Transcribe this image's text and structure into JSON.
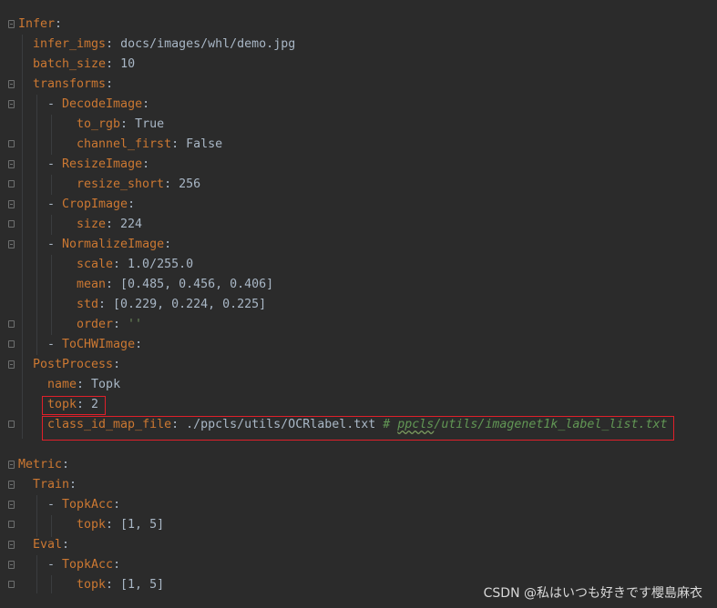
{
  "editor": {
    "lines": [
      {
        "key": "Infer",
        "sep": ":",
        "val": "",
        "comment": ""
      },
      {
        "key": "infer_imgs",
        "sep": ": ",
        "val": "docs/images/whl/demo.jpg",
        "comment": ""
      },
      {
        "key": "batch_size",
        "sep": ": ",
        "val": "10",
        "comment": ""
      },
      {
        "key": "transforms",
        "sep": ":",
        "val": "",
        "comment": ""
      },
      {
        "dash": "- ",
        "key": "DecodeImage",
        "sep": ":",
        "val": "",
        "comment": ""
      },
      {
        "key": "to_rgb",
        "sep": ": ",
        "val": "True",
        "comment": ""
      },
      {
        "key": "channel_first",
        "sep": ": ",
        "val": "False",
        "comment": ""
      },
      {
        "dash": "- ",
        "key": "ResizeImage",
        "sep": ":",
        "val": "",
        "comment": ""
      },
      {
        "key": "resize_short",
        "sep": ": ",
        "val": "256",
        "comment": ""
      },
      {
        "dash": "- ",
        "key": "CropImage",
        "sep": ":",
        "val": "",
        "comment": ""
      },
      {
        "key": "size",
        "sep": ": ",
        "val": "224",
        "comment": ""
      },
      {
        "dash": "- ",
        "key": "NormalizeImage",
        "sep": ":",
        "val": "",
        "comment": ""
      },
      {
        "key": "scale",
        "sep": ": ",
        "val": "1.0/255.0",
        "comment": ""
      },
      {
        "key": "mean",
        "sep": ": ",
        "val": "[0.485, 0.456, 0.406]",
        "comment": ""
      },
      {
        "key": "std",
        "sep": ": ",
        "val": "[0.229, 0.224, 0.225]",
        "comment": ""
      },
      {
        "key": "order",
        "sep": ": ",
        "val": "''",
        "comment": ""
      },
      {
        "dash": "- ",
        "key": "ToCHWImage",
        "sep": ":",
        "val": "",
        "comment": ""
      },
      {
        "key": "PostProcess",
        "sep": ":",
        "val": "",
        "comment": ""
      },
      {
        "key": "name",
        "sep": ": ",
        "val": "Topk",
        "comment": ""
      },
      {
        "key": "topk",
        "sep": ": ",
        "val": "2",
        "comment": ""
      },
      {
        "key": "class_id_map_file",
        "sep": ": ",
        "val": "./ppcls/utils/OCRlabel.txt",
        "comment_hash": "# ",
        "comment_squig": "ppcls",
        "comment": "/utils/imagenet1k_label_list.txt"
      },
      {
        "key": "",
        "sep": "",
        "val": "",
        "comment": ""
      },
      {
        "key": "Metric",
        "sep": ":",
        "val": "",
        "comment": ""
      },
      {
        "key": "Train",
        "sep": ":",
        "val": "",
        "comment": ""
      },
      {
        "dash": "- ",
        "key": "TopkAcc",
        "sep": ":",
        "val": "",
        "comment": ""
      },
      {
        "key": "topk",
        "sep": ": ",
        "val": "[1, 5]",
        "comment": ""
      },
      {
        "key": "Eval",
        "sep": ":",
        "val": "",
        "comment": ""
      },
      {
        "dash": "- ",
        "key": "TopkAcc",
        "sep": ":",
        "val": "",
        "comment": ""
      },
      {
        "key": "topk",
        "sep": ": ",
        "val": "[1, 5]",
        "comment": ""
      }
    ]
  },
  "watermark": "CSDN @私はいつも好きです櫻島麻衣",
  "colors": {
    "background": "#2b2b2b",
    "key": "#cc7832",
    "text": "#a9b7c6",
    "string": "#6a8759",
    "comment": "#629755",
    "highlight_box": "#e0202a"
  }
}
